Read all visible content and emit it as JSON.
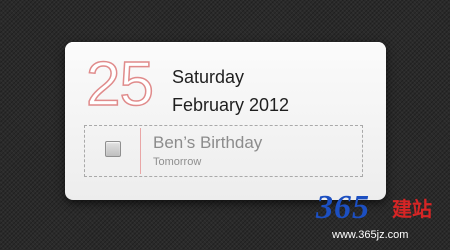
{
  "widget": {
    "day_number": "25",
    "weekday": "Saturday",
    "month_year": "February 2012",
    "event": {
      "title": "Ben’s Birthday",
      "subtitle": "Tomorrow",
      "completed": false
    },
    "colors": {
      "accent": "#e08b8b",
      "divider": "#e9a6a6",
      "card": "#f5f5f5",
      "background": "#2a2a2a"
    }
  },
  "watermark": {
    "digits": "365",
    "cn_text": "建站",
    "url": "www.365jz.com",
    "colors": {
      "digits": "#1c4fc1",
      "cn_text": "#d62525"
    }
  }
}
